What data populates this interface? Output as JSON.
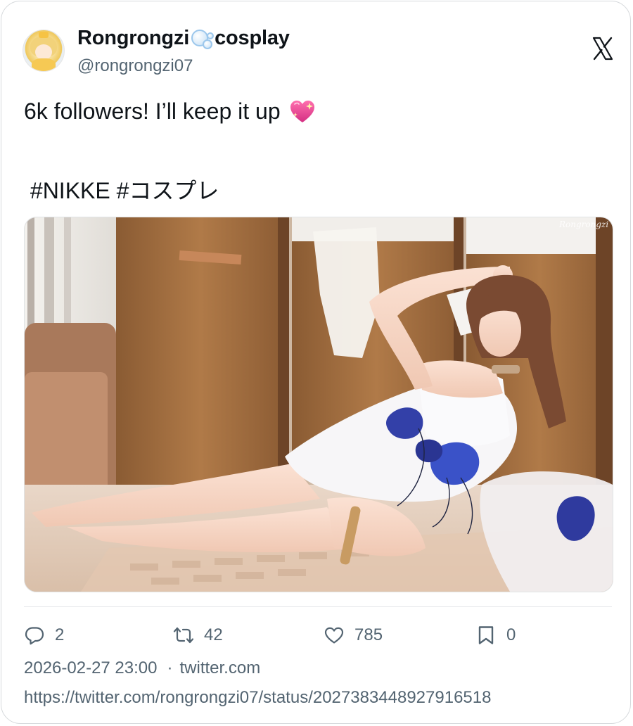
{
  "post": {
    "display_name_part1": "Rongrongzi",
    "display_name_part2": "cosplay",
    "name_emoji_icon": "bubbles-icon",
    "handle": "@rongrongzi07",
    "platform_icon": "x-logo-icon",
    "text_line1": "6k followers! I’ll keep it up",
    "text_emoji_icon": "sparkling-heart-icon",
    "text_line2": " #NIKKE #コスプレ",
    "media": {
      "alt": "Cosplay photo",
      "watermark": "Rongrongzi"
    }
  },
  "actions": {
    "replies": "2",
    "retweets": "42",
    "likes": "785",
    "bookmarks": "0"
  },
  "meta": {
    "timestamp": "2026-02-27 23:00",
    "separator": "·",
    "source": "twitter.com",
    "url": "https://twitter.com/rongrongzi07/status/2027383448927916518"
  },
  "colors": {
    "text": "#0f1419",
    "secondary": "#536471",
    "border": "#d6d9dc"
  }
}
